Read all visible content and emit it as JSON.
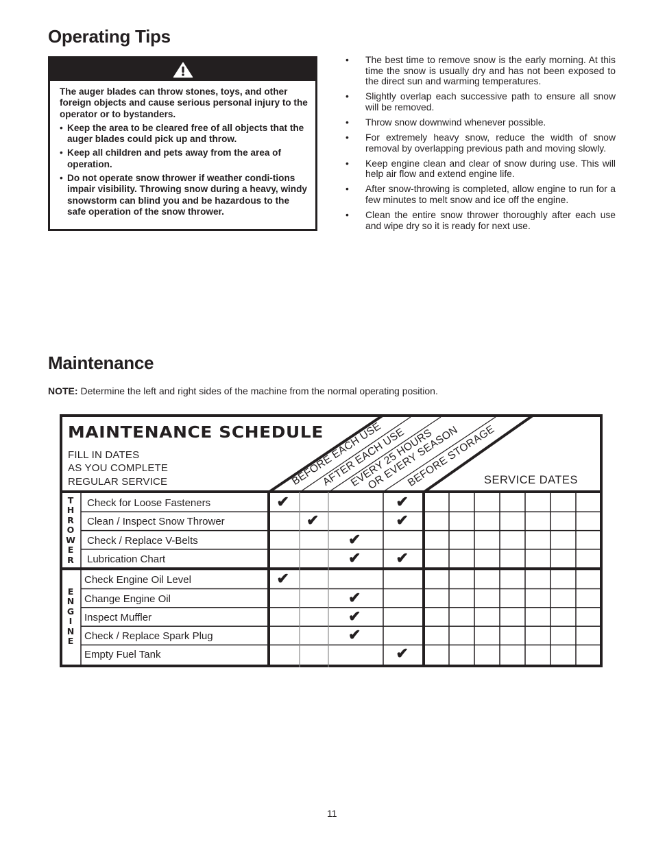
{
  "operating_tips": {
    "title": "Operating Tips",
    "warning": {
      "icon": "warning-triangle-icon",
      "intro": "The auger blades can throw stones, toys, and other foreign objects and cause serious personal injury to the operator or to bystanders.",
      "bullets": [
        "Keep the area to be cleared free of all objects that the auger blades could pick up and throw.",
        "Keep all children and pets away from the area of operation.",
        "Do not operate snow thrower if weather condi-tions impair visibility.  Throwing snow during a heavy, windy snowstorm can blind you and be hazardous to the safe operation of the snow thrower."
      ]
    },
    "tips": [
      "The best time to remove snow is the early morning. At this time the snow is usually dry and has not been exposed to the direct sun and warming temperatures.",
      "Slightly overlap each successive path to ensure all snow will be removed.",
      "Throw snow downwind whenever possible.",
      "For extremely heavy snow, reduce the width of snow removal by overlapping previous path and moving slowly.",
      "Keep engine clean and clear of snow during use. This will help air flow and extend engine life.",
      "After snow-throwing is completed, allow engine to run for a few minutes to melt snow and ice off the engine.",
      "Clean the entire snow thrower thoroughly after each use and wipe dry so it is ready for next use."
    ]
  },
  "maintenance": {
    "title": "Maintenance",
    "note_label": "NOTE:",
    "note_text": " Determine the left and right sides of the machine from the normal operating position.",
    "schedule": {
      "title": "MAINTENANCE SCHEDULE",
      "subtitle_lines": [
        "FILL IN DATES",
        "AS YOU COMPLETE",
        "REGULAR SERVICE"
      ],
      "interval_headers": [
        [
          "BEFORE EACH USE"
        ],
        [
          "AFTER EACH USE"
        ],
        [
          "EVERY 25 HOURS",
          "OR EVERY SEASON"
        ],
        [
          "BEFORE STORAGE"
        ]
      ],
      "service_dates_label": "SERVICE DATES",
      "service_date_columns": 7,
      "check_glyph": "✔",
      "groups": [
        {
          "label": "THROWER",
          "rows": [
            {
              "task": "Check for Loose Fasteners",
              "checks": [
                true,
                false,
                false,
                true
              ],
              "dates": [
                "",
                "",
                "",
                "",
                "",
                "",
                ""
              ]
            },
            {
              "task": "Clean / Inspect Snow Thrower",
              "checks": [
                false,
                true,
                false,
                true
              ],
              "dates": [
                "",
                "",
                "",
                "",
                "",
                "",
                ""
              ]
            },
            {
              "task": "Check / Replace V-Belts",
              "checks": [
                false,
                false,
                true,
                false
              ],
              "dates": [
                "",
                "",
                "",
                "",
                "",
                "",
                ""
              ]
            },
            {
              "task": "Lubrication Chart",
              "checks": [
                false,
                false,
                true,
                true
              ],
              "dates": [
                "",
                "",
                "",
                "",
                "",
                "",
                ""
              ]
            }
          ]
        },
        {
          "label": "ENGINE",
          "rows": [
            {
              "task": "Check Engine Oil Level",
              "checks": [
                true,
                false,
                false,
                false
              ],
              "dates": [
                "",
                "",
                "",
                "",
                "",
                "",
                ""
              ]
            },
            {
              "task": "Change Engine Oil",
              "checks": [
                false,
                false,
                true,
                false
              ],
              "dates": [
                "",
                "",
                "",
                "",
                "",
                "",
                ""
              ]
            },
            {
              "task": "Inspect Muffler",
              "checks": [
                false,
                false,
                true,
                false
              ],
              "dates": [
                "",
                "",
                "",
                "",
                "",
                "",
                ""
              ]
            },
            {
              "task": "Check / Replace Spark Plug",
              "checks": [
                false,
                false,
                true,
                false
              ],
              "dates": [
                "",
                "",
                "",
                "",
                "",
                "",
                ""
              ]
            },
            {
              "task": "Empty Fuel Tank",
              "checks": [
                false,
                false,
                false,
                true
              ],
              "dates": [
                "",
                "",
                "",
                "",
                "",
                "",
                ""
              ]
            }
          ]
        }
      ]
    }
  },
  "page_number": "11"
}
